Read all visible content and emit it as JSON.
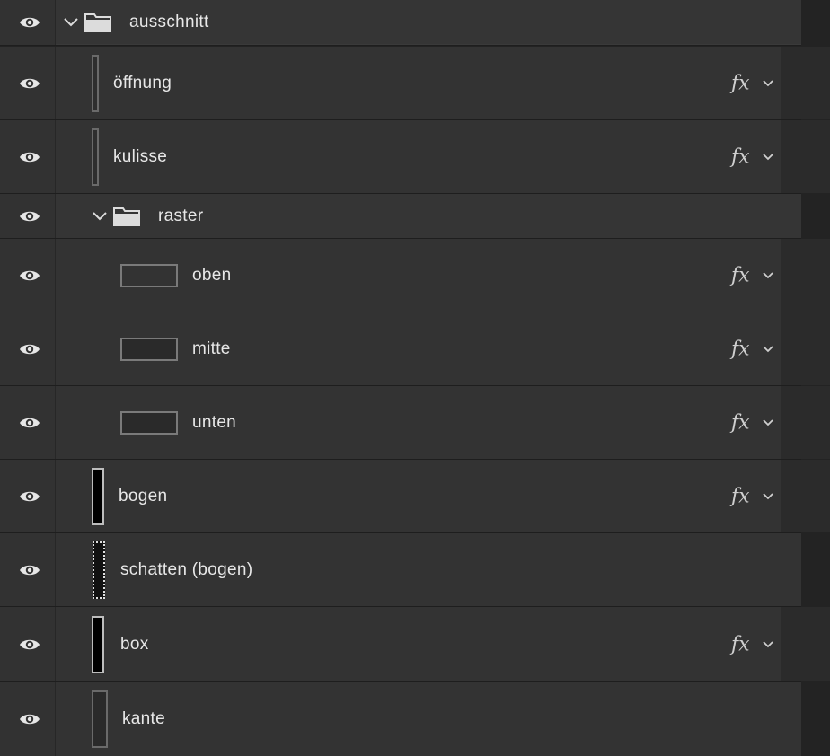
{
  "layers": [
    {
      "id": "ausschnitt",
      "label": "ausschnitt",
      "kind": "group",
      "indent": 0,
      "selected": true,
      "fx": false
    },
    {
      "id": "oeffnung",
      "label": "öffnung",
      "kind": "layer",
      "thumb": "tall",
      "fx": true
    },
    {
      "id": "kulisse",
      "label": "kulisse",
      "kind": "layer",
      "thumb": "tall",
      "fx": true
    },
    {
      "id": "raster",
      "label": "raster",
      "kind": "group",
      "indent": 1,
      "fx": false
    },
    {
      "id": "oben",
      "label": "oben",
      "kind": "layer",
      "thumb": "wide",
      "fx": true
    },
    {
      "id": "mitte",
      "label": "mitte",
      "kind": "layer",
      "thumb": "wide",
      "fx": true
    },
    {
      "id": "unten",
      "label": "unten",
      "kind": "layer",
      "thumb": "wide-dark",
      "fx": true
    },
    {
      "id": "bogen",
      "label": "bogen",
      "kind": "layer",
      "thumb": "black",
      "fx": true
    },
    {
      "id": "schatten",
      "label": "schatten (bogen)",
      "kind": "layer",
      "thumb": "dotted",
      "fx": false
    },
    {
      "id": "box",
      "label": "box",
      "kind": "layer",
      "thumb": "black",
      "fx": true
    },
    {
      "id": "kante",
      "label": "kante",
      "kind": "layer",
      "thumb": "plain",
      "fx": false
    }
  ],
  "fx_label": "fx",
  "icons": {
    "visibility": "eye-icon",
    "expand": "chevron-down-icon",
    "group": "folder-icon"
  },
  "colors": {
    "panel_bg": "#333333",
    "selected_bg": "#4a4a4a",
    "text": "#e8e8e8"
  }
}
